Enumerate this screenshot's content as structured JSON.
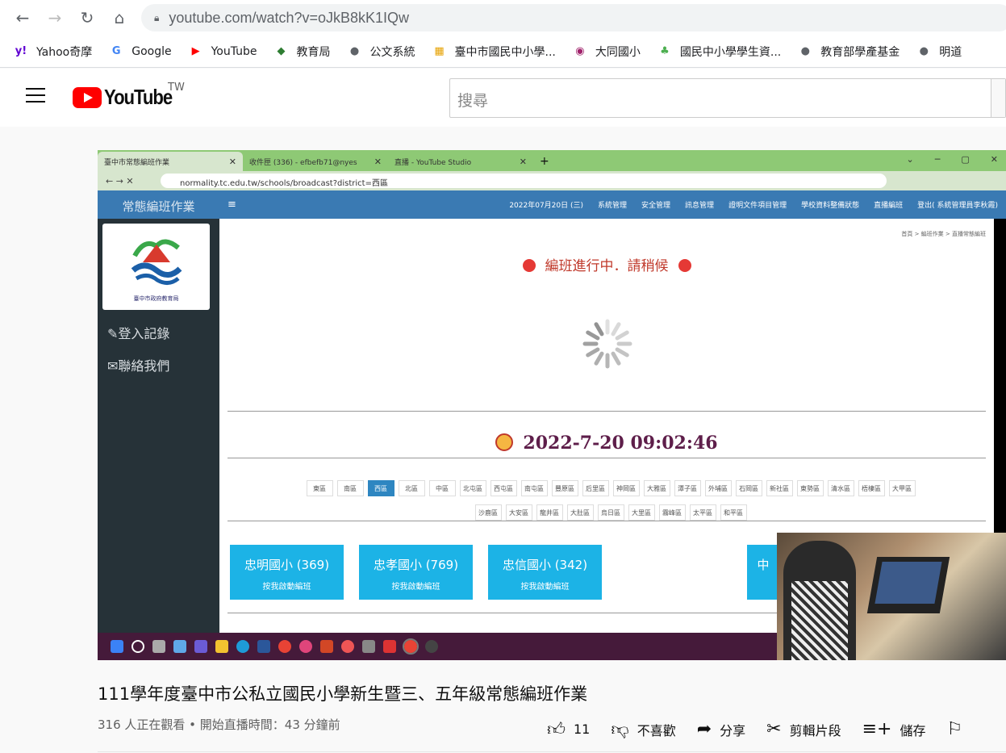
{
  "browser": {
    "url": "youtube.com/watch?v=oJkB8kK1IQw",
    "bookmarks": [
      {
        "label": "Yahoo奇摩",
        "icon": "yahoo-icon",
        "glyph": "y!",
        "color": "#6001d2"
      },
      {
        "label": "Google",
        "icon": "google-icon",
        "glyph": "G",
        "color": "#4285f4"
      },
      {
        "label": "YouTube",
        "icon": "youtube-icon",
        "glyph": "▶",
        "color": "#ff0000"
      },
      {
        "label": "教育局",
        "icon": "education-bureau-icon",
        "glyph": "◆",
        "color": "#2e7d32"
      },
      {
        "label": "公文系統",
        "icon": "globe-icon",
        "glyph": "●",
        "color": "#5f6368"
      },
      {
        "label": "臺中市國民中小學...",
        "icon": "grid-icon",
        "glyph": "▦",
        "color": "#e6a100"
      },
      {
        "label": "大同國小",
        "icon": "school-icon",
        "glyph": "◉",
        "color": "#a0226b"
      },
      {
        "label": "國民中小學學生資...",
        "icon": "sprout-icon",
        "glyph": "♣",
        "color": "#4caf50"
      },
      {
        "label": "教育部學產基金",
        "icon": "globe-icon",
        "glyph": "●",
        "color": "#5f6368"
      },
      {
        "label": "明道",
        "icon": "globe-icon",
        "glyph": "●",
        "color": "#5f6368"
      }
    ]
  },
  "youtube": {
    "logo_text": "YouTube",
    "region": "TW",
    "search_placeholder": "搜尋"
  },
  "video_frame": {
    "tabs": [
      {
        "label": "臺中市常態編班作業",
        "active": true
      },
      {
        "label": "收件匣 (336) - efbefb71@nyes",
        "active": false
      },
      {
        "label": "直播 - YouTube Studio",
        "active": false
      }
    ],
    "url": "normality.tc.edu.tw/schools/broadcast?district=西區",
    "sidebar_title": "常態編班作業",
    "logo_caption": "臺中市政府教育局",
    "sidebar_links": [
      "登入記錄",
      "聯絡我們"
    ],
    "top_menu": [
      "2022年07月20日 (三)",
      "系統管理",
      "安全管理",
      "訊息管理",
      "證明文件項目管理",
      "學校資料整備狀態",
      "直播編班",
      "登出( 系統管理員李秋霞)"
    ],
    "breadcrumb": "首頁 > 編班作業 > 直播常態編班",
    "status_text": "編班進行中．請稍候",
    "clock": "2022-7-20 09:02:46",
    "districts_row1": [
      "東區",
      "南區",
      "西區",
      "北區",
      "中區",
      "北屯區",
      "西屯區",
      "南屯區",
      "豐原區",
      "后里區",
      "神岡區",
      "大雅區",
      "潭子區",
      "外埔區",
      "石岡區",
      "新社區",
      "東勢區",
      "清水區",
      "梧棲區",
      "大甲區"
    ],
    "districts_row2": [
      "沙鹿區",
      "大安區",
      "龍井區",
      "大肚區",
      "烏日區",
      "大里區",
      "霧峰區",
      "太平區",
      "和平區"
    ],
    "selected_district": "西區",
    "schools": [
      {
        "name": "忠明國小 (369)",
        "button": "按我啟動編班"
      },
      {
        "name": "忠孝國小 (769)",
        "button": "按我啟動編班"
      },
      {
        "name": "忠信國小 (342)",
        "button": "按我啟動編班"
      },
      {
        "name": "中",
        "button": ""
      }
    ]
  },
  "video_info": {
    "title": "111學年度臺中市公私立國民小學新生暨三、五年級常態編班作業",
    "meta": "316 人正在觀看 • 開始直播時間：43 分鐘前",
    "like_count": "11",
    "dislike_label": "不喜歡",
    "share_label": "分享",
    "clip_label": "剪輯片段",
    "save_label": "儲存"
  }
}
